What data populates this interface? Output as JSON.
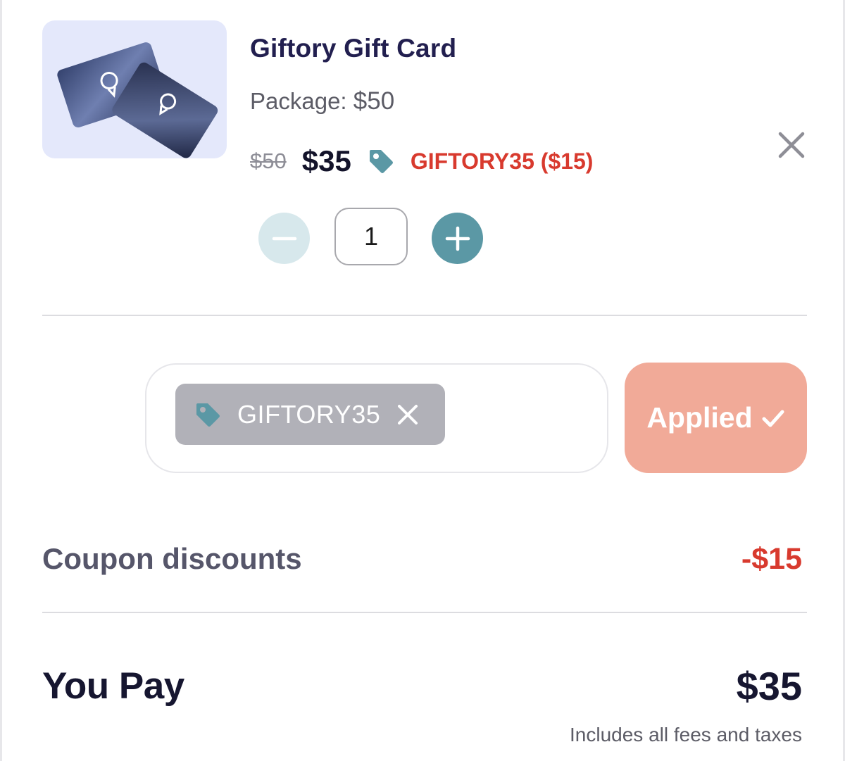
{
  "product": {
    "title": "Giftory Gift Card",
    "package_label": "Package:",
    "package_value": "$50",
    "original_price": "$50",
    "current_price": "$35",
    "coupon_applied_text": "GIFTORY35 ($15)",
    "image_icon": "gift-card-image"
  },
  "quantity": {
    "value": "1",
    "minus_icon": "minus-icon",
    "plus_icon": "plus-icon"
  },
  "coupon": {
    "code": "GIFTORY35",
    "button_label": "Applied",
    "button_icon": "check-icon"
  },
  "summary": {
    "discount_label": "Coupon discounts",
    "discount_value": "-$15",
    "total_label": "You Pay",
    "total_value": "$35",
    "note": "Includes all fees and taxes"
  },
  "colors": {
    "accent_teal": "#5b98a5",
    "discount_red": "#d83a2e",
    "applied_button": "#f1aa98",
    "title_navy": "#221f4f"
  }
}
